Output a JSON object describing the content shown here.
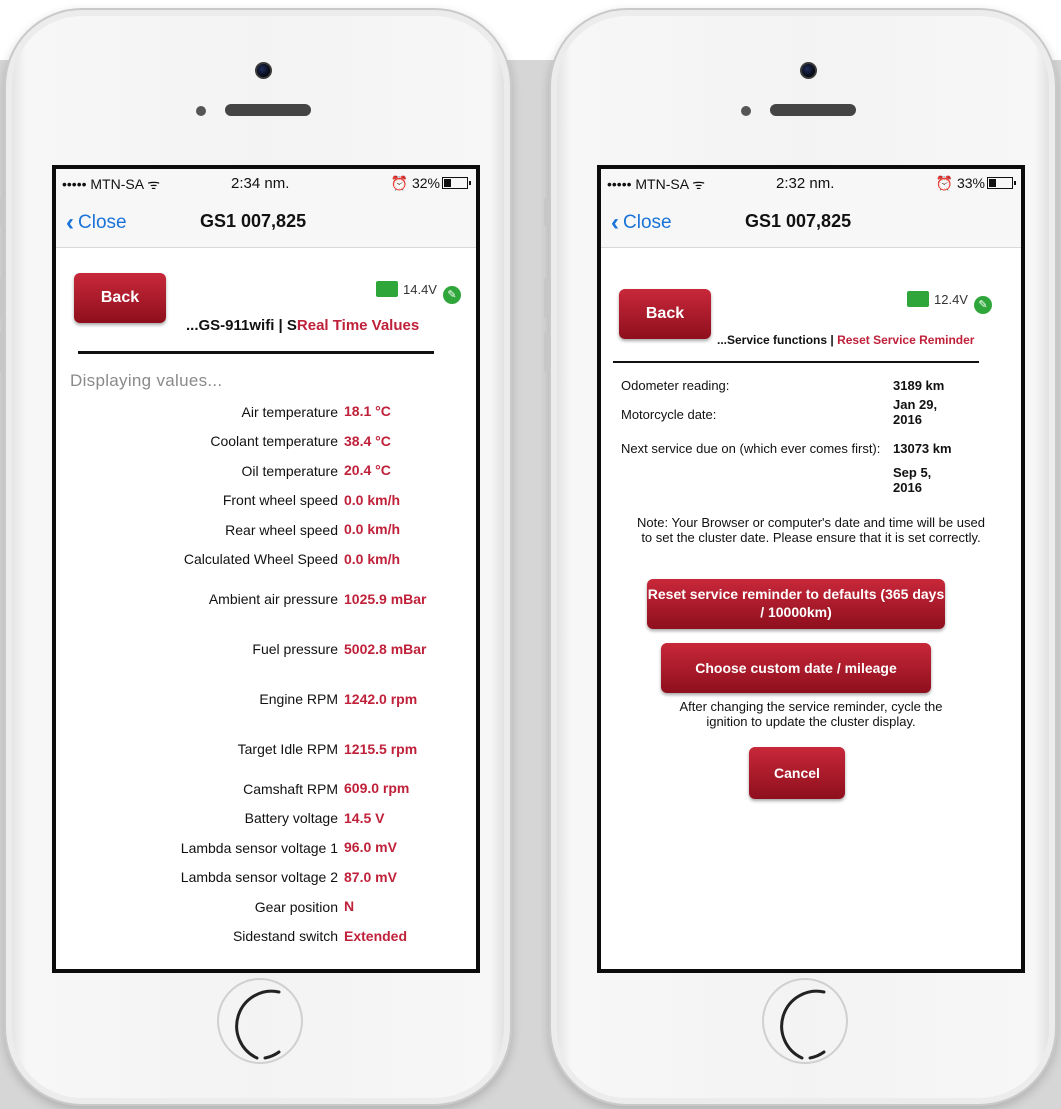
{
  "left_phone": {
    "status": {
      "carrier": "••••• MTN-SA",
      "wifi": "ᯤ",
      "time": "2:34 nm.",
      "alarm": "⏰",
      "battery": "32%",
      "battery_level": 0.32
    },
    "nav": {
      "close_label": "Close",
      "title": "GS1 007,825"
    },
    "back_label": "Back",
    "voltage": "14.4V",
    "breadcrumb_prefix": "...GS-911wifi | S",
    "breadcrumb_current": "Real Time Values",
    "displaying": "Displaying values...",
    "values": [
      {
        "label": "Air temperature",
        "value": "18.1 °C"
      },
      {
        "label": "Coolant temperature",
        "value": "38.4 °C"
      },
      {
        "label": "Oil temperature",
        "value": "20.4 °C"
      },
      {
        "label": "Front wheel speed",
        "value": "0.0 km/h"
      },
      {
        "label": "Rear wheel speed",
        "value": "0.0 km/h"
      },
      {
        "label": "Calculated Wheel Speed",
        "value": "0.0 km/h"
      },
      {
        "label": "Ambient air pressure",
        "value": "1025.9 mBar"
      },
      {
        "label": "Fuel pressure",
        "value": "5002.8 mBar"
      },
      {
        "label": "Engine RPM",
        "value": "1242.0 rpm"
      },
      {
        "label": "Target Idle RPM",
        "value": "1215.5 rpm"
      },
      {
        "label": "Camshaft RPM",
        "value": "609.0 rpm"
      },
      {
        "label": "Battery voltage",
        "value": "14.5 V"
      },
      {
        "label": "Lambda sensor voltage 1",
        "value": "96.0 mV"
      },
      {
        "label": "Lambda sensor voltage 2",
        "value": "87.0 mV"
      },
      {
        "label": "Gear position",
        "value": "N"
      },
      {
        "label": "Sidestand switch",
        "value": "Extended"
      }
    ]
  },
  "right_phone": {
    "status": {
      "carrier": "••••• MTN-SA",
      "wifi": "ᯤ",
      "time": "2:32 nm.",
      "alarm": "⏰",
      "battery": "33%",
      "battery_level": 0.33
    },
    "nav": {
      "close_label": "Close",
      "title": "GS1 007,825"
    },
    "back_label": "Back",
    "voltage": "12.4V",
    "breadcrumb_prefix": "...Service functions | ",
    "breadcrumb_current": "Reset Service Reminder",
    "odometer_label": "Odometer reading:",
    "odometer_value": "3189 km",
    "date_label": "Motorcycle date:",
    "date_value": "Jan 29, 2016",
    "next_service_label": "Next service due on (which ever comes first):",
    "next_service_km": "13073 km",
    "next_service_date": "Sep 5, 2016",
    "note": "Note: Your Browser or computer's date and time will be used to set the cluster date. Please ensure that it is set correctly.",
    "reset_defaults_label": "Reset service reminder to defaults (365 days / 10000km)",
    "custom_label": "Choose custom date / mileage",
    "after_note": "After changing the service reminder, cycle the ignition to update the cluster display.",
    "cancel_label": "Cancel"
  },
  "colors": {
    "accent_red": "#c0213a",
    "button_red": "#a5182a",
    "ios_blue": "#1a73d8",
    "battery_green": "#2fa63a"
  },
  "icons": [
    "wifi-icon",
    "alarm-icon",
    "battery-icon",
    "chevron-left-icon",
    "car-battery-icon",
    "edit-pencil-icon"
  ]
}
